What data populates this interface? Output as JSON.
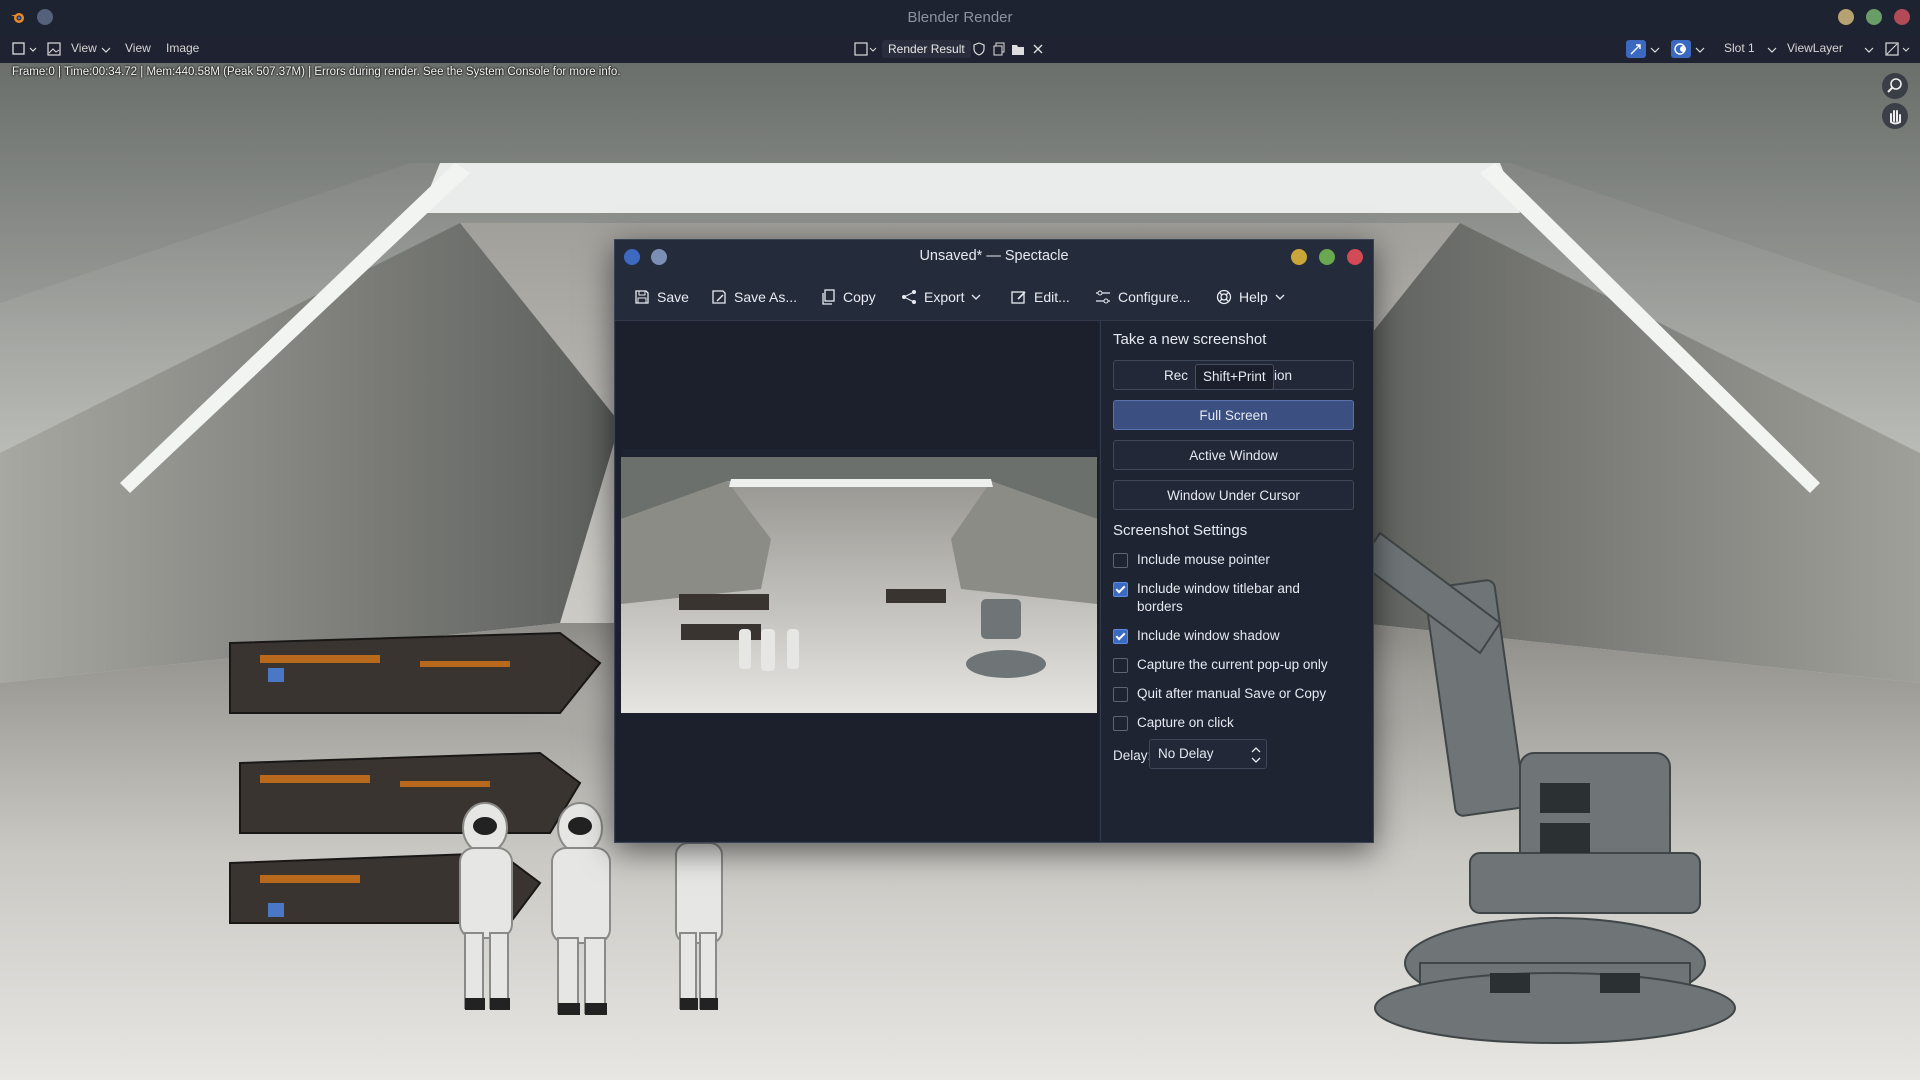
{
  "blender": {
    "window_title": "Blender Render",
    "menu": {
      "view1": "View",
      "view2": "View",
      "image": "Image"
    },
    "render_result": "Render Result",
    "slot": "Slot 1",
    "view_layer": "ViewLayer",
    "status": "Frame:0 | Time:00:34.72 | Mem:440.58M (Peak 507.37M) | Errors during render. See the System Console for more info."
  },
  "spectacle": {
    "title": "Unsaved* — Spectacle",
    "toolbar": {
      "save": "Save",
      "save_as": "Save As...",
      "copy": "Copy",
      "export": "Export",
      "edit": "Edit...",
      "configure": "Configure...",
      "help": "Help"
    },
    "new_heading": "Take a new screenshot",
    "region_btn_left": "Rec",
    "region_btn_right": "ion",
    "tooltip": "Shift+Print",
    "full_screen": "Full Screen",
    "active_window": "Active Window",
    "window_under_cursor": "Window Under Cursor",
    "settings_heading": "Screenshot Settings",
    "options": [
      {
        "label": "Include mouse pointer",
        "checked": false
      },
      {
        "label": "Include window titlebar and borders",
        "checked": true
      },
      {
        "label": "Include window shadow",
        "checked": true
      },
      {
        "label": "Capture the current pop-up only",
        "checked": false
      },
      {
        "label": "Quit after manual Save or Copy",
        "checked": false
      },
      {
        "label": "Capture on click",
        "checked": false
      }
    ],
    "delay_label": "Delay:",
    "delay_value": "No Delay"
  },
  "colors": {
    "titlebar": "#1d2331",
    "accent": "#3d6ac1",
    "minimize": "#c9a53a",
    "maximize": "#6aa84f",
    "close": "#d24a56"
  }
}
